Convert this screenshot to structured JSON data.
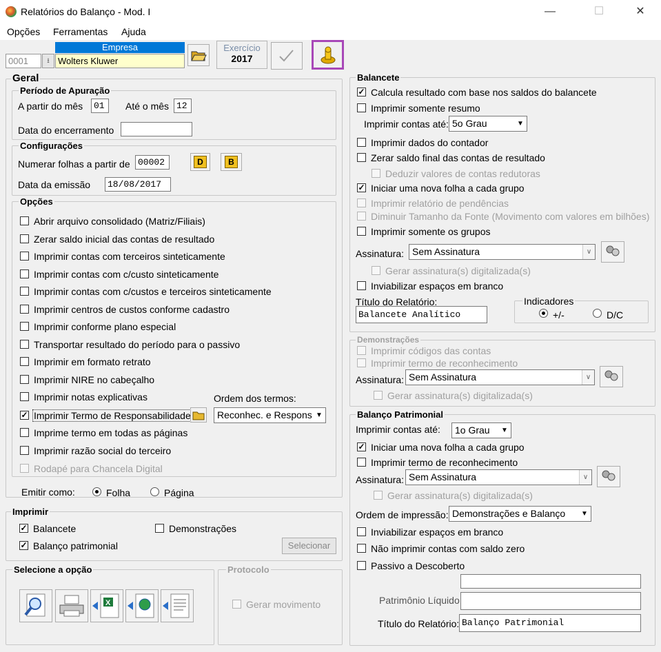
{
  "window": {
    "title": "Relatórios do Balanço - Mod. I",
    "minimize": "—",
    "maximize": "☐",
    "close": "✕"
  },
  "menu": {
    "opcoes": "Opções",
    "ferramentas": "Ferramentas",
    "ajuda": "Ajuda"
  },
  "empresa": {
    "label": "Empresa",
    "code": "0001",
    "name": "Wolters Kluwer"
  },
  "exercicio": {
    "label": "Exercício",
    "year": "2017"
  },
  "geral": {
    "title": "Geral",
    "periodo": {
      "title": "Período de Apuração",
      "from_label": "A partir do mês",
      "from_value": "01",
      "to_label": "Até o mês",
      "to_value": "12",
      "encerramento_label": "Data do encerramento",
      "encerramento_value": ""
    },
    "config": {
      "title": "Configurações",
      "folhas_label": "Numerar folhas a partir de",
      "folhas_value": "00002",
      "btn_d": "D",
      "btn_b": "B",
      "emissao_label": "Data da emissão",
      "emissao_value": "18/08/2017"
    },
    "opcoes": {
      "title": "Opções",
      "items": [
        {
          "label": "Abrir arquivo consolidado (Matriz/Filiais)",
          "checked": false
        },
        {
          "label": "Zerar saldo inicial das contas de resultado",
          "checked": false
        },
        {
          "label": "Imprimir contas com terceiros sinteticamente",
          "checked": false
        },
        {
          "label": "Imprimir contas com c/custo sinteticamente",
          "checked": false
        },
        {
          "label": "Imprimir contas com c/custos e terceiros sinteticamente",
          "checked": false
        },
        {
          "label": "Imprimir centros de custos conforme cadastro",
          "checked": false
        },
        {
          "label": "Imprimir conforme plano especial",
          "checked": false
        },
        {
          "label": "Transportar resultado do período para o passivo",
          "checked": false
        },
        {
          "label": "Imprimir em formato retrato",
          "checked": false
        },
        {
          "label": "Imprimir NIRE no cabeçalho",
          "checked": false
        },
        {
          "label": "Imprimir notas explicativas",
          "checked": false
        },
        {
          "label": "Imprimir Termo de Responsabilidade",
          "checked": true
        },
        {
          "label": "Imprime termo em todas as páginas",
          "checked": false
        },
        {
          "label": "Imprimir razão social do terceiro",
          "checked": false
        },
        {
          "label": "Rodapé para Chancela Digital",
          "checked": false,
          "disabled": true
        }
      ],
      "ordem_label": "Ordem dos termos:",
      "ordem_value": "Reconhec. e Respons."
    },
    "emitir": {
      "label": "Emitir como:",
      "folha": "Folha",
      "pagina": "Página"
    }
  },
  "imprimir": {
    "title": "Imprimir",
    "balancete": "Balancete",
    "demonstracoes": "Demonstrações",
    "balanco": "Balanço patrimonial",
    "selecionar": "Selecionar"
  },
  "selecione": {
    "title": "Selecione a opção"
  },
  "protocolo": {
    "title": "Protocolo",
    "gerar": "Gerar movimento"
  },
  "balancete": {
    "title": "Balancete",
    "items": [
      {
        "label": "Calcula resultado com base nos saldos do balancete",
        "checked": true
      },
      {
        "label": "Imprimir somente resumo",
        "checked": false
      }
    ],
    "contas_ate_label": "Imprimir contas até:",
    "contas_ate_value": "5o Grau",
    "items2": [
      {
        "label": "Imprimir dados do contador",
        "checked": false
      },
      {
        "label": "Zerar saldo final das contas de resultado",
        "checked": false
      },
      {
        "label": "Deduzir valores de contas redutoras",
        "checked": false,
        "disabled": true
      },
      {
        "label": "Iniciar uma nova folha a cada grupo",
        "checked": true
      },
      {
        "label": "Imprimir relatório de pendências",
        "checked": false,
        "disabled": true
      },
      {
        "label": "Diminuir Tamanho da Fonte (Movimento com valores em bilhões)",
        "checked": false,
        "disabled": true
      },
      {
        "label": "Imprimir somente os grupos",
        "checked": false
      }
    ],
    "assinatura_label": "Assinatura:",
    "assinatura_value": "Sem Assinatura",
    "gerar_assinatura": "Gerar assinatura(s) digitalizada(s)",
    "inviabilizar": "Inviabilizar espaços em branco",
    "titulo_label": "Título do Relatório:",
    "titulo_value": "Balancete Analítico",
    "indicadores": {
      "title": "Indicadores",
      "opt1": "+/-",
      "opt2": "D/C"
    }
  },
  "demonstracoes": {
    "title": "Demonstrações",
    "codigos": "Imprimir códigos das contas",
    "termo": "Imprimir termo de reconhecimento",
    "assinatura_label": "Assinatura:",
    "assinatura_value": "Sem Assinatura",
    "gerar_assinatura": "Gerar assinatura(s) digitalizada(s)"
  },
  "balanco": {
    "title": "Balanço Patrimonial",
    "contas_ate_label": "Imprimir contas até:",
    "contas_ate_value": "1o Grau",
    "nova_folha": "Iniciar uma nova folha a cada grupo",
    "termo": "Imprimir termo de reconhecimento",
    "assinatura_label": "Assinatura:",
    "assinatura_value": "Sem Assinatura",
    "gerar_assinatura": "Gerar assinatura(s) digitalizada(s)",
    "ordem_label": "Ordem de impressão:",
    "ordem_value": "Demonstrações e Balanço",
    "inviabilizar": "Inviabilizar espaços em branco",
    "nao_imprimir": "Não imprimir contas com saldo zero",
    "passivo": "Passivo a Descoberto",
    "pl_label": "Patrimônio Líquido",
    "titulo_label": "Título do Relatório:",
    "titulo_value": "Balanço Patrimonial"
  },
  "colors": {
    "accent_purple": "#a848b8",
    "header_blue": "#0078d7",
    "empresa_bg": "#ffffcc"
  }
}
